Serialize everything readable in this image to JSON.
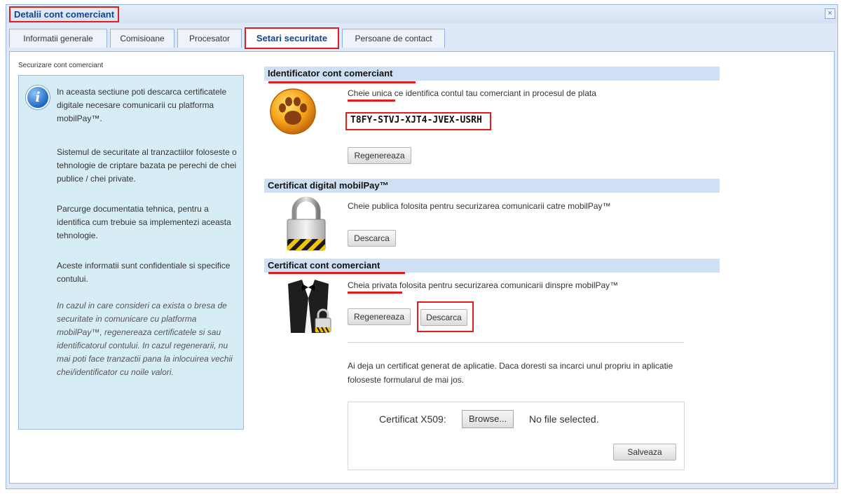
{
  "window": {
    "title": "Detalii cont comerciant",
    "close_symbol": "×",
    "tabs": [
      {
        "label": "Informatii generale",
        "active": false
      },
      {
        "label": "Comisioane",
        "active": false
      },
      {
        "label": "Procesator",
        "active": false
      },
      {
        "label": "Setari securitate",
        "active": true
      },
      {
        "label": "Persoane de contact",
        "active": false
      }
    ]
  },
  "page": {
    "section_label": "Securizare cont comerciant",
    "info": {
      "icon": "info-icon",
      "icon_glyph": "i",
      "p1": "In aceasta sectiune poti descarca certificatele digitale necesare comunicarii cu platforma mobilPay™.",
      "p2": "Sistemul de securitate al tranzactiilor foloseste o tehnologie de criptare bazata pe perechi de chei publice / chei private.",
      "p3": "Parcurge documentatia tehnica, pentru a identifica cum trebuie sa implementezi aceasta tehnologie.",
      "p4": "Aceste informatii sunt confidentiale si specifice contului.",
      "p5": "In cazul in care consideri ca exista o bresa de securitate in comunicare cu platforma mobilPay™, regenereaza certificatele si sau identificatorul contului. In cazul regenerarii, nu mai poti face tranzactii pana la inlocuirea vechii chei/identificator cu noile valori."
    },
    "identifier": {
      "header": "Identificator cont comerciant",
      "icon": "paw-icon",
      "description": "Cheie unica ce identifica contul tau comerciant in procesul de plata",
      "value": "T8FY-STVJ-XJT4-JVEX-USRH",
      "regenerate_label": "Regenereaza"
    },
    "mobilpay_cert": {
      "header": "Certificat digital mobilPay™",
      "icon": "padlock-icon",
      "description": "Cheie publica folosita pentru securizarea comunicarii catre mobilPay™",
      "download_label": "Descarca"
    },
    "merchant_cert": {
      "header": "Certificat cont comerciant",
      "icon": "tuxedo-lock-icon",
      "description": "Cheia privata folosita pentru securizarea comunicarii dinspre mobilPay™",
      "regenerate_label": "Regenereaza",
      "download_label": "Descarca",
      "existing_note": "Ai deja un certificat generat de aplicatie. Daca doresti sa incarci unul propriu in aplicatie foloseste formularul de mai jos."
    },
    "upload": {
      "label": "Certificat X509:",
      "browse_label": "Browse...",
      "status": "No file selected.",
      "save_label": "Salveaza"
    }
  },
  "colors": {
    "accent_red": "#e21b1b",
    "header_blue": "#cfe0f5",
    "info_panel_bg": "#d7edf6",
    "title_text": "#15428b"
  }
}
